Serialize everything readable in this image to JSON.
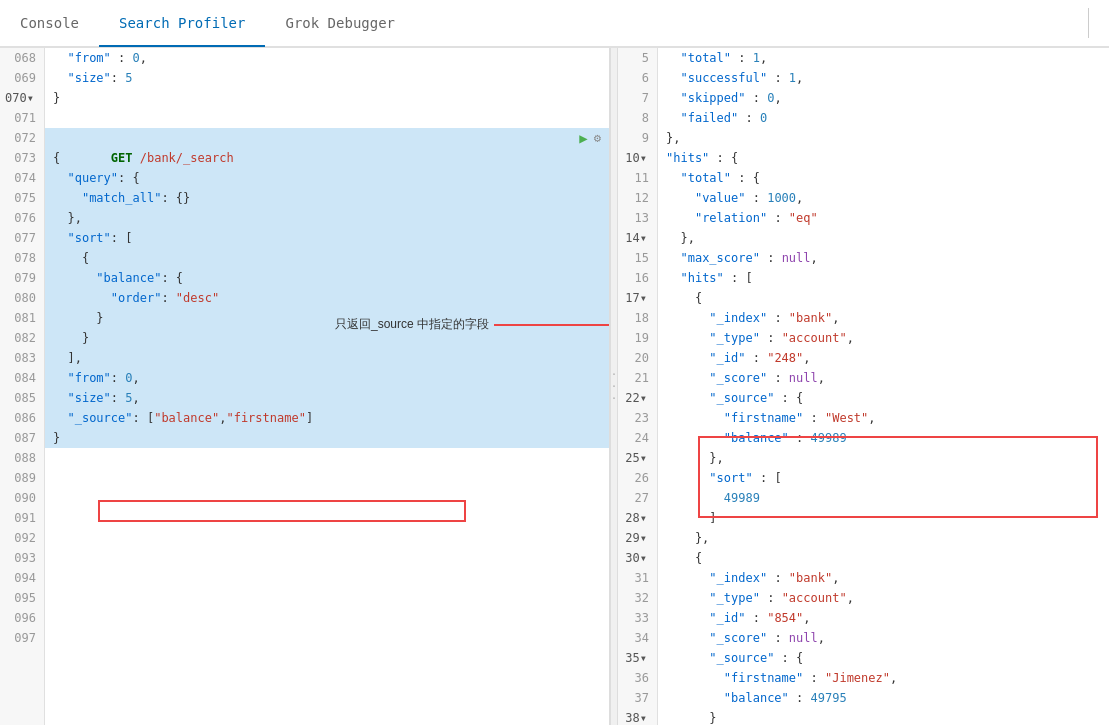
{
  "nav": {
    "tabs": [
      {
        "label": "Console",
        "active": false
      },
      {
        "label": "Search Profiler",
        "active": true
      },
      {
        "label": "Grok Debugger",
        "active": false
      }
    ]
  },
  "left_panel": {
    "lines": [
      {
        "num": "068",
        "arrow": false,
        "content": "  \"from\" : 0,"
      },
      {
        "num": "069",
        "arrow": false,
        "content": "  \"size\": 5"
      },
      {
        "num": "070",
        "arrow": true,
        "content": "}"
      },
      {
        "num": "071",
        "arrow": false,
        "content": ""
      },
      {
        "num": "072",
        "arrow": false,
        "content": "GET /bank/_search",
        "get_line": true
      },
      {
        "num": "073",
        "arrow": false,
        "content": "{"
      },
      {
        "num": "074",
        "arrow": false,
        "content": "  \"query\": {"
      },
      {
        "num": "075",
        "arrow": false,
        "content": "    \"match_all\": {}"
      },
      {
        "num": "076",
        "arrow": false,
        "content": "  },"
      },
      {
        "num": "077",
        "arrow": false,
        "content": "  \"sort\": ["
      },
      {
        "num": "078",
        "arrow": false,
        "content": "    {"
      },
      {
        "num": "079",
        "arrow": false,
        "content": "      \"balance\": {"
      },
      {
        "num": "080",
        "arrow": false,
        "content": "        \"order\": \"desc\""
      },
      {
        "num": "081",
        "arrow": false,
        "content": "      }"
      },
      {
        "num": "082",
        "arrow": false,
        "content": "    }"
      },
      {
        "num": "083",
        "arrow": false,
        "content": "  ],"
      },
      {
        "num": "084",
        "arrow": false,
        "content": "  \"from\": 0,"
      },
      {
        "num": "085",
        "arrow": false,
        "content": "  \"size\": 5,"
      },
      {
        "num": "086",
        "arrow": false,
        "content": "  \"_source\": [\"balance\",\"firstname\"]"
      },
      {
        "num": "087",
        "arrow": false,
        "content": "}"
      },
      {
        "num": "088",
        "arrow": false,
        "content": ""
      },
      {
        "num": "089",
        "arrow": false,
        "content": ""
      },
      {
        "num": "090",
        "arrow": false,
        "content": ""
      },
      {
        "num": "091",
        "arrow": false,
        "content": ""
      },
      {
        "num": "092",
        "arrow": false,
        "content": ""
      },
      {
        "num": "093",
        "arrow": false,
        "content": ""
      },
      {
        "num": "094",
        "arrow": false,
        "content": ""
      },
      {
        "num": "095",
        "arrow": false,
        "content": ""
      },
      {
        "num": "096",
        "arrow": false,
        "content": ""
      },
      {
        "num": "097",
        "arrow": false,
        "content": ""
      }
    ],
    "annotation": "只返回_source 中指定的字段"
  },
  "right_panel": {
    "lines": [
      {
        "num": "5",
        "arrow": false,
        "content": "  \"total\" : 1,"
      },
      {
        "num": "6",
        "arrow": false,
        "content": "  \"successful\" : 1,"
      },
      {
        "num": "7",
        "arrow": false,
        "content": "  \"skipped\" : 0,"
      },
      {
        "num": "8",
        "arrow": false,
        "content": "  \"failed\" : 0"
      },
      {
        "num": "9",
        "arrow": false,
        "content": "},"
      },
      {
        "num": "10",
        "arrow": true,
        "content": "\"hits\" : {"
      },
      {
        "num": "11",
        "arrow": false,
        "content": "  \"total\" : {"
      },
      {
        "num": "12",
        "arrow": false,
        "content": "    \"value\" : 1000,"
      },
      {
        "num": "13",
        "arrow": false,
        "content": "    \"relation\" : \"eq\""
      },
      {
        "num": "14",
        "arrow": true,
        "content": "  },"
      },
      {
        "num": "15",
        "arrow": false,
        "content": "  \"max_score\" : null,"
      },
      {
        "num": "16",
        "arrow": false,
        "content": "  \"hits\" : ["
      },
      {
        "num": "17",
        "arrow": true,
        "content": "    {"
      },
      {
        "num": "18",
        "arrow": false,
        "content": "      \"_index\" : \"bank\","
      },
      {
        "num": "19",
        "arrow": false,
        "content": "      \"_type\" : \"account\","
      },
      {
        "num": "20",
        "arrow": false,
        "content": "      \"_id\" : \"248\","
      },
      {
        "num": "21",
        "arrow": false,
        "content": "      \"_score\" : null,"
      },
      {
        "num": "22",
        "arrow": true,
        "content": "      \"_source\" : {"
      },
      {
        "num": "23",
        "arrow": false,
        "content": "        \"firstname\" : \"West\","
      },
      {
        "num": "24",
        "arrow": false,
        "content": "        \"balance\" : 49989"
      },
      {
        "num": "25",
        "arrow": true,
        "content": "      },"
      },
      {
        "num": "26",
        "arrow": false,
        "content": "      \"sort\" : ["
      },
      {
        "num": "27",
        "arrow": false,
        "content": "        49989"
      },
      {
        "num": "28",
        "arrow": true,
        "content": "      ]"
      },
      {
        "num": "29",
        "arrow": true,
        "content": "    },"
      },
      {
        "num": "30",
        "arrow": true,
        "content": "    {"
      },
      {
        "num": "31",
        "arrow": false,
        "content": "      \"_index\" : \"bank\","
      },
      {
        "num": "32",
        "arrow": false,
        "content": "      \"_type\" : \"account\","
      },
      {
        "num": "33",
        "arrow": false,
        "content": "      \"_id\" : \"854\","
      },
      {
        "num": "34",
        "arrow": false,
        "content": "      \"_score\" : null,"
      },
      {
        "num": "35",
        "arrow": true,
        "content": "      \"_source\" : {"
      },
      {
        "num": "36",
        "arrow": false,
        "content": "        \"firstname\" : \"Jimenez\","
      },
      {
        "num": "37",
        "arrow": false,
        "content": "        \"balance\" : 49795"
      },
      {
        "num": "38",
        "arrow": true,
        "content": "      }"
      }
    ]
  },
  "separator": {
    "dots": "·\n·\n·"
  }
}
